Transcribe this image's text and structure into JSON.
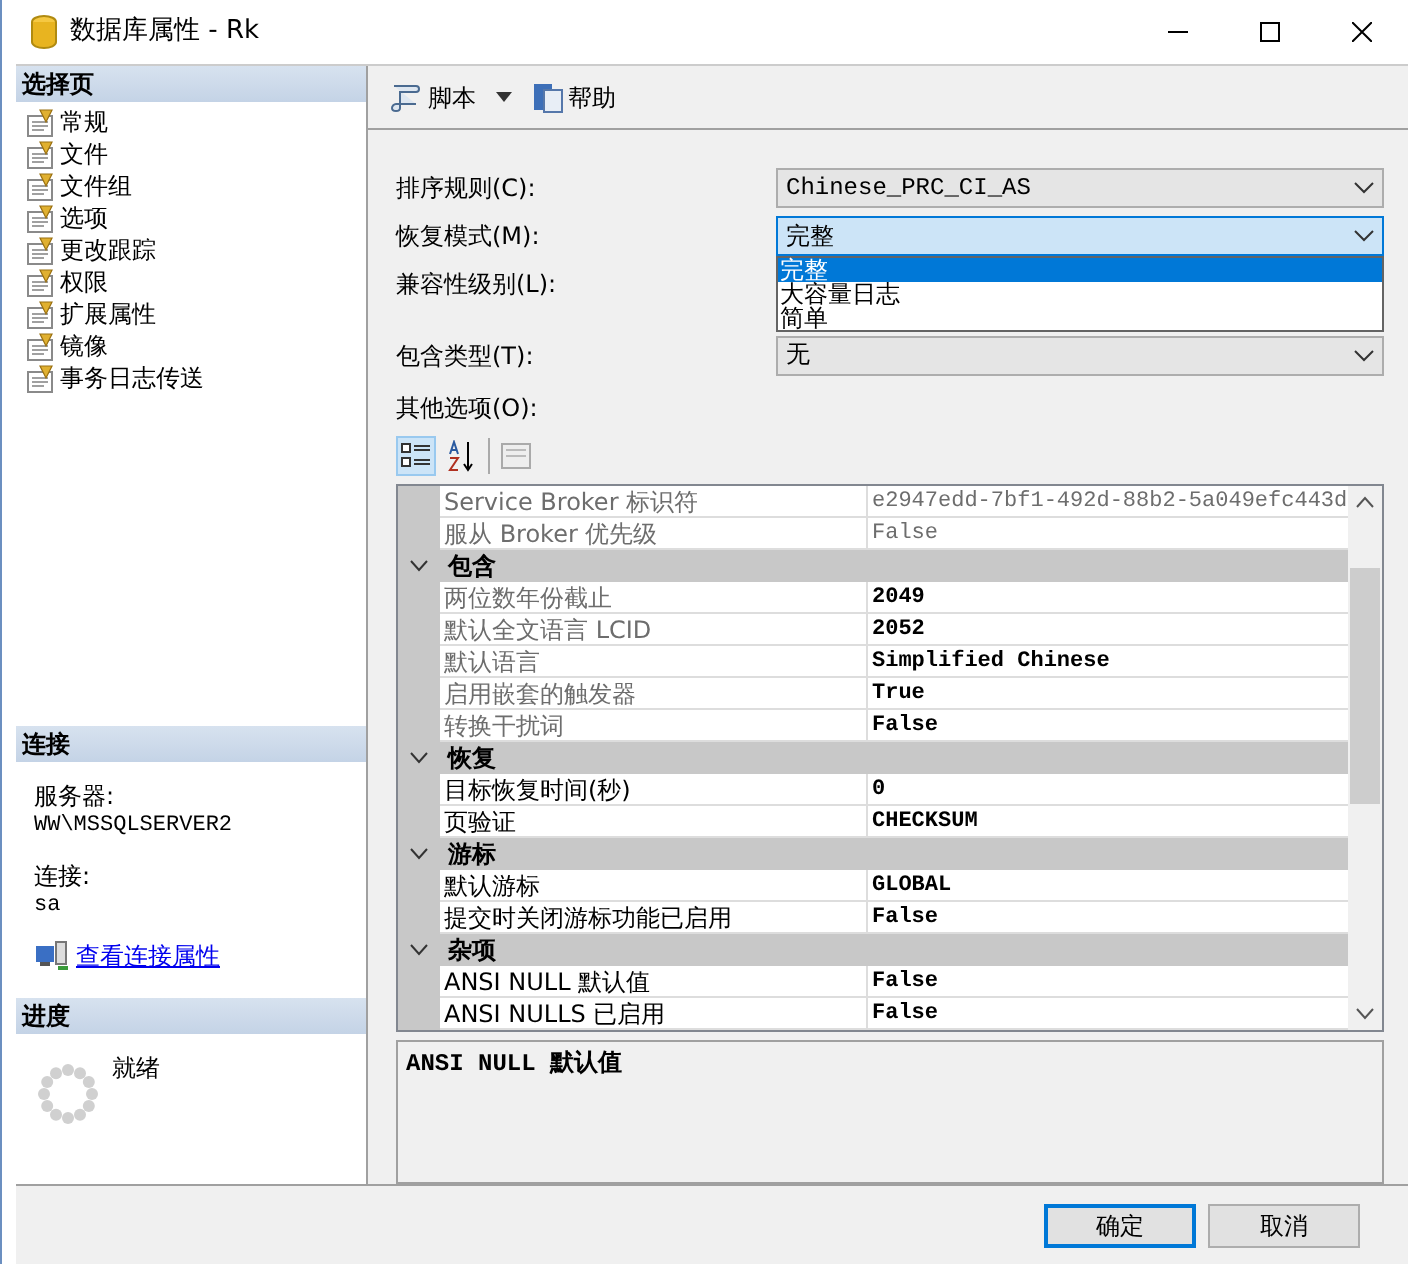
{
  "window": {
    "title": "数据库属性 - Rk"
  },
  "sidebar": {
    "header": "选择页",
    "items": [
      {
        "label": "常规"
      },
      {
        "label": "文件"
      },
      {
        "label": "文件组"
      },
      {
        "label": "选项"
      },
      {
        "label": "更改跟踪"
      },
      {
        "label": "权限"
      },
      {
        "label": "扩展属性"
      },
      {
        "label": "镜像"
      },
      {
        "label": "事务日志传送"
      }
    ]
  },
  "connection": {
    "header": "连接",
    "server_label": "服务器:",
    "server": "WW\\MSSQLSERVER2",
    "login_label": "连接:",
    "login": "sa",
    "link": "查看连接属性"
  },
  "progress": {
    "header": "进度",
    "status": "就绪"
  },
  "toolbar": [
    {
      "kind": "script",
      "label": "脚本"
    },
    {
      "kind": "help",
      "label": "帮助"
    }
  ],
  "fields": [
    {
      "label": "排序规则(C):",
      "value": "Chinese_PRC_CI_AS",
      "expanded": false
    },
    {
      "label": "恢复模式(M):",
      "value": "完整",
      "expanded": true,
      "options": [
        {
          "label": "完整",
          "selected": true
        },
        {
          "label": "大容量日志",
          "selected": false
        },
        {
          "label": "简单",
          "selected": false
        }
      ]
    },
    {
      "label": "兼容性级别(L):"
    },
    {
      "label": "包含类型(T):",
      "value": "无",
      "expanded": false
    }
  ],
  "other_options_label": "其他选项(O):",
  "grid": {
    "rows": [
      {
        "kind": "property",
        "name": "Service Broker 标识符",
        "value": "e2947edd-7bf1-492d-88b2-5a049efc443d",
        "readonly": true,
        "bold": false
      },
      {
        "kind": "property",
        "name": "服从 Broker 优先级",
        "value": "False",
        "readonly": true,
        "bold": false
      },
      {
        "kind": "category",
        "name": "包含",
        "expanded": true
      },
      {
        "kind": "property",
        "name": "两位数年份截止",
        "value": "2049",
        "readonly": true,
        "bold": true
      },
      {
        "kind": "property",
        "name": "默认全文语言 LCID",
        "value": "2052",
        "readonly": true,
        "bold": true
      },
      {
        "kind": "property",
        "name": "默认语言",
        "value": "Simplified Chinese",
        "readonly": true,
        "bold": true
      },
      {
        "kind": "property",
        "name": "启用嵌套的触发器",
        "value": "True",
        "readonly": true,
        "bold": true
      },
      {
        "kind": "property",
        "name": "转换干扰词",
        "value": "False",
        "readonly": true,
        "bold": true
      },
      {
        "kind": "category",
        "name": "恢复",
        "expanded": true
      },
      {
        "kind": "property",
        "name": "目标恢复时间(秒)",
        "value": "0",
        "readonly": false,
        "bold": true
      },
      {
        "kind": "property",
        "name": "页验证",
        "value": "CHECKSUM",
        "readonly": false,
        "bold": true
      },
      {
        "kind": "category",
        "name": "游标",
        "expanded": true
      },
      {
        "kind": "property",
        "name": "默认游标",
        "value": "GLOBAL",
        "readonly": false,
        "bold": true
      },
      {
        "kind": "property",
        "name": "提交时关闭游标功能已启用",
        "value": "False",
        "readonly": false,
        "bold": true
      },
      {
        "kind": "category",
        "name": "杂项",
        "expanded": true
      },
      {
        "kind": "property",
        "name": "ANSI NULL 默认值",
        "value": "False",
        "readonly": false,
        "bold": true
      },
      {
        "kind": "property",
        "name": "ANSI NULLS 已启用",
        "value": "False",
        "readonly": false,
        "bold": true
      }
    ]
  },
  "description": "ANSI NULL 默认值",
  "buttons": [
    {
      "label": "确定",
      "default": true
    },
    {
      "label": "取消",
      "default": false
    }
  ]
}
